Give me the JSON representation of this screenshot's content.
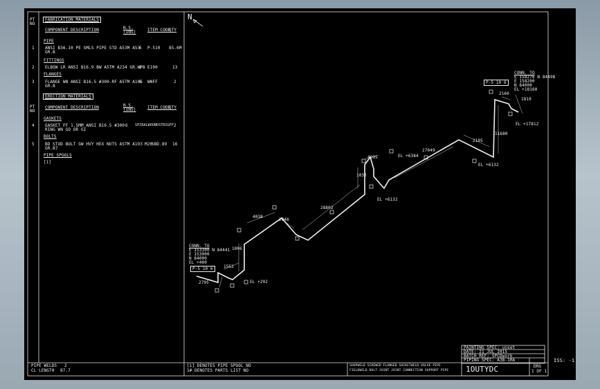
{
  "bom": {
    "fab_title": "FABRICATION MATERIALS",
    "pt_no": "PT\nNO",
    "hdr_component": "COMPONENT DESCRIPTION",
    "hdr_ns": "N.S.\n(INS)",
    "hdr_item": "ITEM CODE",
    "hdr_qty": "QTY",
    "cat_pipe": "PIPE",
    "pipe_no": "1",
    "pipe_desc": "ANSI B36.10 PE SMLS PIPE STD A53M A53",
    "pipe_desc2": "GR.B",
    "pipe_ns": "6",
    "pipe_code": "P-510",
    "pipe_qty": "85.6M",
    "cat_fittings": "FITTINGS",
    "fit_no": "2",
    "fit_desc": "ELBOW LR ANSI B16.9 BW A5TM A234 GR.WPB",
    "fit_ns": "6",
    "fit_code": "E190",
    "fit_qty": "13",
    "cat_flanges": "FLANGES",
    "fl_no": "3",
    "fl_desc": "FLANGE WN ANSI B16.5 #300.RF A5TM A105",
    "fl_desc2": "GR.B",
    "fl_ns": "6",
    "fl_code": "WNFF",
    "fl_qty": "2",
    "erec_title": "ERECTION MATERIALS",
    "cat_gaskets": "GASKETS",
    "gk_no": "4",
    "gk_desc": "GASKET FF 1.5MM ANSI B16.5 #300 ",
    "gk_desc2": "RING WN GO OR GI",
    "gk_ns": "6",
    "gk_code": "SPIRALWOUNDSTDSGFF",
    "gk_qty": "2",
    "cat_bolts": "BOLTS",
    "bt_no": "5",
    "bt_desc": "BD STUD BOLT GW HVY HEX NUTS ASTM A193",
    "bt_desc2": "GR.B7",
    "bt_ns": "M20",
    "bt_code": "SBD.89",
    "bt_qty": "16",
    "spools": "PIPE SPOOLS",
    "spool1": "[1]"
  },
  "footer": {
    "pipe_welds": "PIPE WELDS",
    "pipe_welds_val": "2",
    "cl_length": "CL LENGTH",
    "cl_length_val": "87.7",
    "note1": "[1] DENOTES PIPE SPOOL NO",
    "note2": "1# DENOTES PARTS LIST NO",
    "legend1": "SHOPWELD  SCREWED  FLANGED  SOCKETWELD  VALVE  PIPE",
    "legend2": "FIELDWELD  BOLT  JOINT  JOINT  CONNECTION  SUPPORT  PIPE",
    "painting": "PAINTING SPEC: unset",
    "date": "DATE: 21 JUL 2015",
    "batch": "BATCH REF: SPCDwork",
    "spec": "PIPING SPEC: A3B-1RA",
    "drawing": "1OUTYDC",
    "drg_label": "DRG",
    "drg_val": "1 OF 1",
    "iss": "ISS: -1"
  },
  "iso": {
    "north": "N",
    "conn_top_1": "CONN. TO",
    "conn_top_2": "E 158276 N 84498",
    "conn_top_3": "E 158200",
    "conn_top_4": "N 84000",
    "conn_top_5": "EL +18160",
    "conn_bot_1": "CONN. TO",
    "conn_bot_2": "E 153300 N 84441",
    "conn_bot_3": "E 153000",
    "conn_bot_4": "N 84000",
    "conn_bot_5": "EL +400",
    "el_292": "EL +292",
    "el_6132a": "EL +6132",
    "el_6384": "EL +6384",
    "el_6132b": "EL +6132",
    "el_17812": "EL +17812",
    "d_1552": "1552",
    "d_2795": "2795",
    "d_1006": "1006",
    "d_4038": "4038",
    "d_2046": "2046",
    "d_28802": "28802",
    "d_1032": "1032",
    "d_4905": "4905",
    "d_27049": "27049",
    "d_2105": "2105",
    "d_11680": "11680",
    "d_2160": "2160",
    "d_1810": "1810",
    "tag_top": "P-5 10 6",
    "tag_bot": "P-5 10 6"
  }
}
